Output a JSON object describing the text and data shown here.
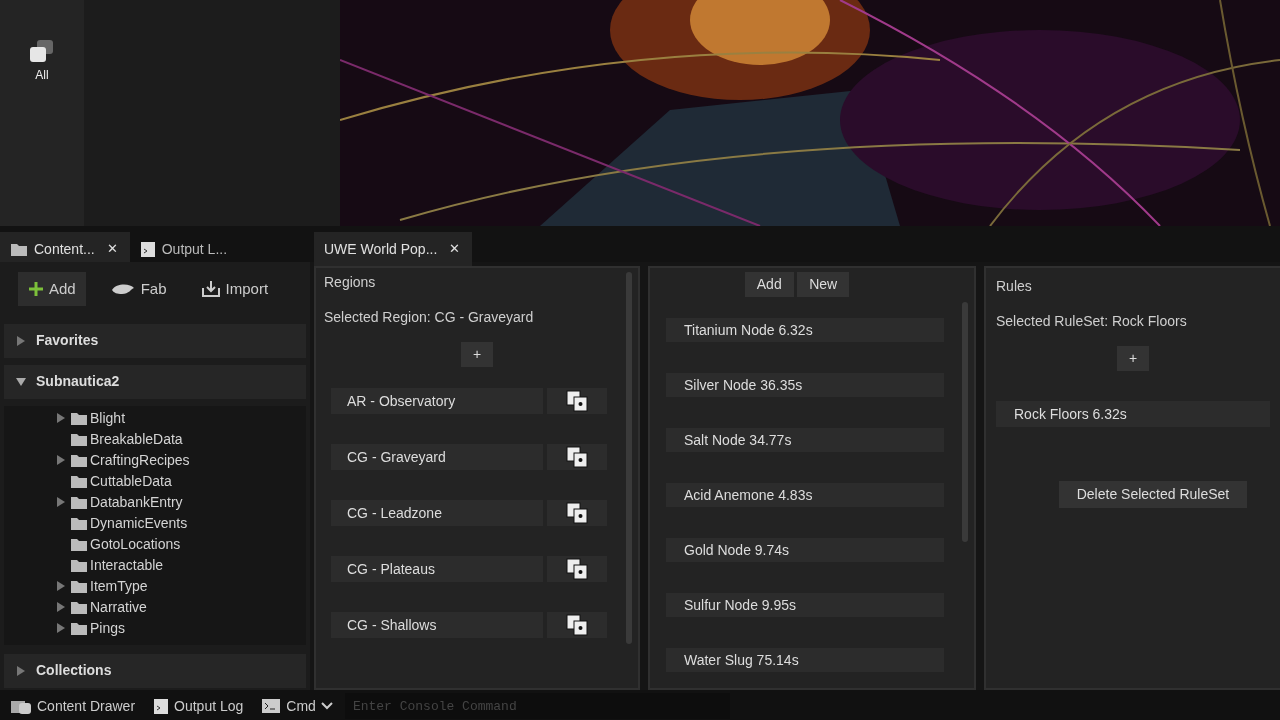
{
  "mode_panel": {
    "items": [
      {
        "label": "All",
        "selected": true
      }
    ]
  },
  "left_tabs": [
    {
      "label": "Content...",
      "selected": true,
      "close": "✕"
    },
    {
      "label": "Output L...",
      "selected": false
    }
  ],
  "document_tabs": [
    {
      "label": "UWE World Pop...",
      "selected": true,
      "close": "✕"
    }
  ],
  "content_toolbar": [
    {
      "label": "Add"
    },
    {
      "label": "Fab"
    },
    {
      "label": "Import"
    }
  ],
  "sections": [
    {
      "label": "Favorites",
      "expanded": false
    },
    {
      "label": "Subnautica2",
      "expanded": true,
      "children": [
        {
          "label": "Blight",
          "has_children": true
        },
        {
          "label": "BreakableData",
          "has_children": false
        },
        {
          "label": "CraftingRecipes",
          "has_children": true
        },
        {
          "label": "CuttableData",
          "has_children": false
        },
        {
          "label": "DatabankEntry",
          "has_children": true
        },
        {
          "label": "DynamicEvents",
          "has_children": false
        },
        {
          "label": "GotoLocations",
          "has_children": false
        },
        {
          "label": "Interactable",
          "has_children": false
        },
        {
          "label": "ItemType",
          "has_children": true
        },
        {
          "label": "Narrative",
          "has_children": true
        },
        {
          "label": "Pings",
          "has_children": true
        }
      ]
    },
    {
      "label": "Collections",
      "expanded": false
    }
  ],
  "regions": {
    "title": "Regions",
    "selected_text": "Selected Region: CG - Graveyard",
    "add_button": "+",
    "items": [
      {
        "label": "AR - Observatory"
      },
      {
        "label": "CG - Graveyard"
      },
      {
        "label": "CG - Leadzone"
      },
      {
        "label": "CG - Plateaus"
      },
      {
        "label": "CG - Shallows"
      }
    ]
  },
  "spawns": {
    "buttons": [
      "Add",
      "New"
    ],
    "items": [
      "Titanium Node 6.32s",
      "Silver Node 36.35s",
      "Salt Node 34.77s",
      "Acid Anemone 4.83s",
      "Gold Node 9.74s",
      "Sulfur Node 9.95s",
      "Water Slug 75.14s"
    ]
  },
  "rules": {
    "title": "Rules",
    "selected_text": "Selected RuleSet: Rock Floors",
    "add_button": "+",
    "items": [
      "Rock Floors 6.32s"
    ],
    "delete_button": "Delete Selected RuleSet"
  },
  "status_bar": {
    "content_drawer": "Content Drawer",
    "output_log": "Output Log",
    "cmd": "Cmd",
    "console_placeholder": "Enter Console Command"
  }
}
